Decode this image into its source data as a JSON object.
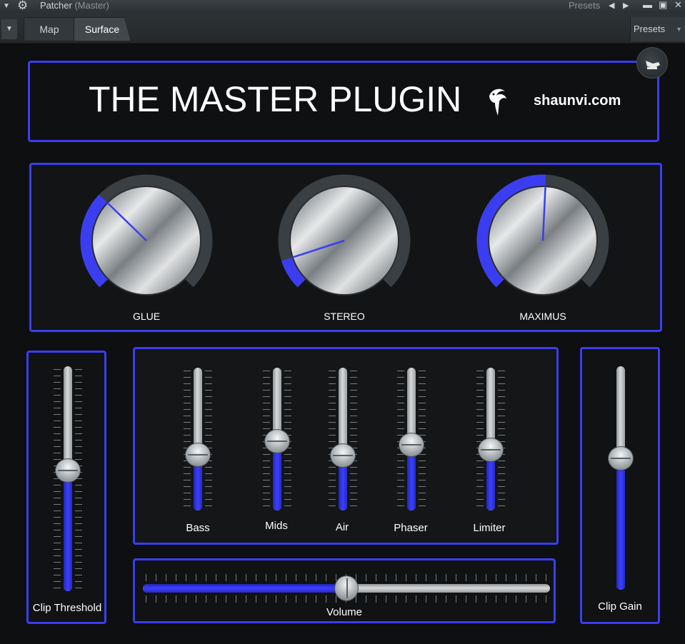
{
  "titlebar": {
    "title": "Patcher",
    "subtitle": "(Master)",
    "presets_label": "Presets",
    "icons": [
      "menu-dropdown-icon",
      "gear-icon",
      "prev-arrow-icon",
      "next-arrow-icon",
      "minimize-icon",
      "maximize-icon",
      "close-icon"
    ]
  },
  "toolbar": {
    "tabs": [
      {
        "label": "Map"
      },
      {
        "label": "Surface",
        "active": true
      }
    ],
    "presets_label": "Presets"
  },
  "header": {
    "title": "THE MASTER PLUGIN",
    "site": "shaunvi.com"
  },
  "knobs": [
    {
      "label": "GLUE",
      "value": 0.33
    },
    {
      "label": "STEREO",
      "value": 0.1
    },
    {
      "label": "MAXIMUS",
      "value": 0.51
    }
  ],
  "clip_threshold": {
    "label": "Clip Threshold",
    "value": 0.54
  },
  "eq_sliders": [
    {
      "label": "Bass",
      "value": 0.37
    },
    {
      "label": "Mids",
      "value": 0.48
    },
    {
      "label": "Air",
      "value": 0.36
    },
    {
      "label": "Phaser",
      "value": 0.45
    },
    {
      "label": "Limiter",
      "value": 0.41
    }
  ],
  "volume": {
    "label": "Volume",
    "value": 0.5
  },
  "clip_gain": {
    "label": "Clip Gain",
    "value": 0.6
  },
  "colors": {
    "accent": "#3b3ef0",
    "background": "#0d0f10",
    "knob_ring": "#3a3f43"
  }
}
